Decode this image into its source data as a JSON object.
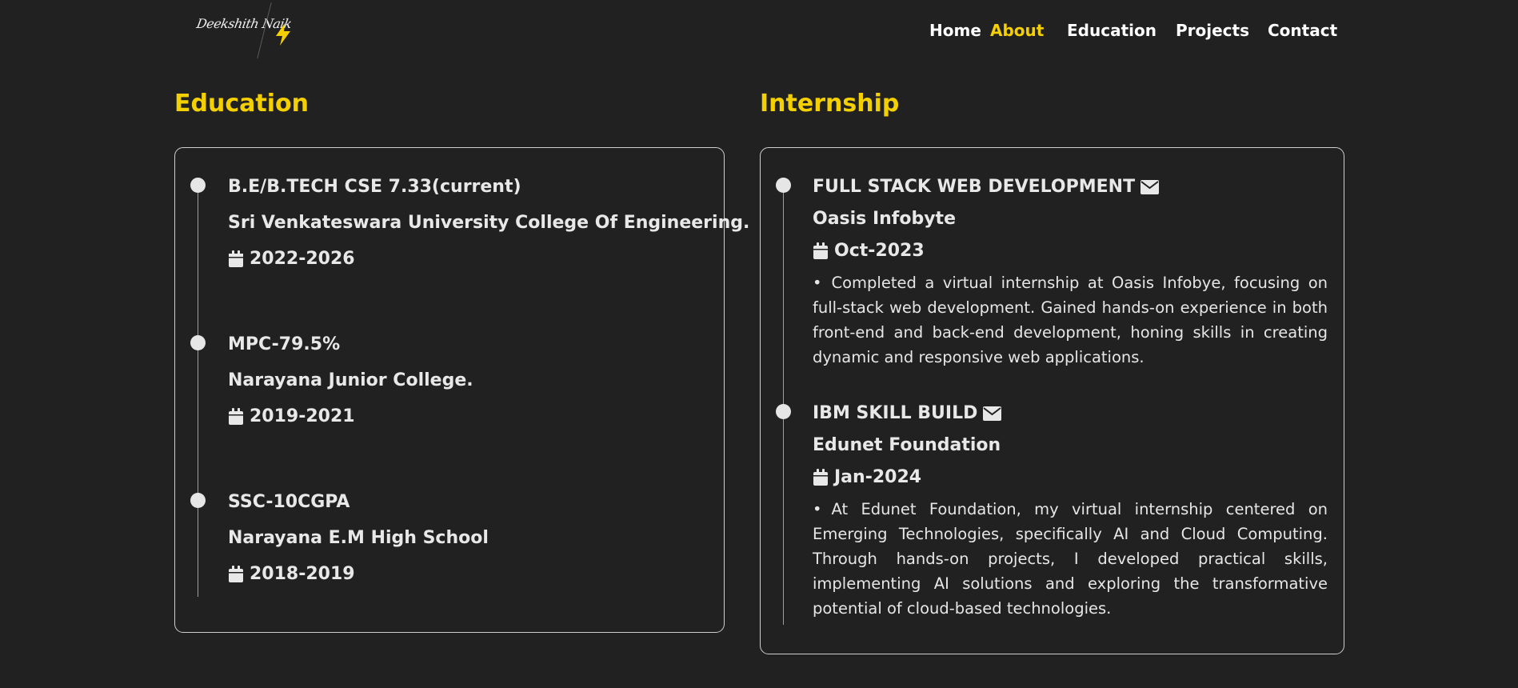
{
  "logo": {
    "text": "Deekshith Naik"
  },
  "nav": {
    "items": [
      {
        "label": "Home"
      },
      {
        "label": "About"
      },
      {
        "label": "Education"
      },
      {
        "label": "Projects"
      },
      {
        "label": "Contact"
      }
    ]
  },
  "education": {
    "title": "Education",
    "entries": [
      {
        "degree": "B.E/B.TECH CSE 7.33(current)",
        "institution": "Sri Venkateswara University College Of Engineering.",
        "years": "2022-2026"
      },
      {
        "degree": "MPC-79.5%",
        "institution": "Narayana Junior College.",
        "years": "2019-2021"
      },
      {
        "degree": "SSC-10CGPA",
        "institution": "Narayana E.M High School",
        "years": "2018-2019"
      }
    ]
  },
  "internship": {
    "title": "Internship",
    "entries": [
      {
        "role": "FULL STACK WEB DEVELOPMENT",
        "company": "Oasis Infobyte",
        "date": "Oct-2023",
        "bullet": "•",
        "description": "Completed a virtual internship at Oasis Infobye, focusing on full-stack web development. Gained hands-on experience in both front-end and back-end development, honing skills in creating dynamic and responsive web applications."
      },
      {
        "role": "IBM SKILL BUILD",
        "company": "Edunet Foundation",
        "date": "Jan-2024",
        "bullet": "•",
        "description": "At Edunet Foundation, my virtual internship centered on Emerging Technologies, specifically AI and Cloud Computing. Through hands-on projects, I developed practical skills, implementing AI solutions and exploring the transformative potential of cloud-based technologies."
      }
    ]
  },
  "colors": {
    "background": "#212121",
    "accent": "#f5d000",
    "text": "#e8e8e8"
  },
  "icons": {
    "logo_mark": "lightning-bolt-icon",
    "date": "calendar-icon",
    "role": "envelope-icon",
    "timeline_marker": "circle-dot"
  }
}
